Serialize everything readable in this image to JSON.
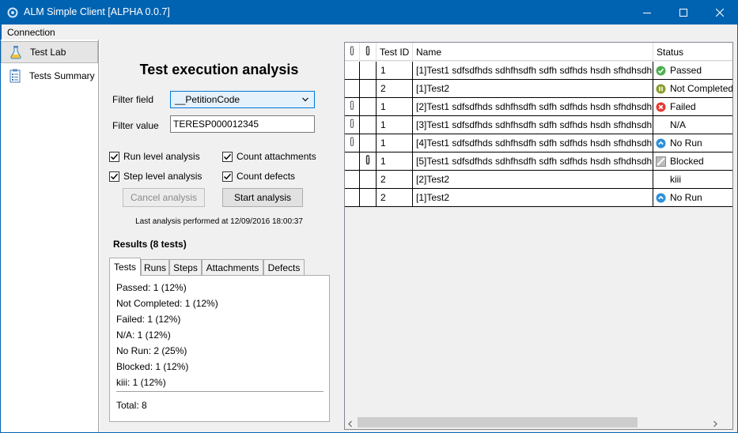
{
  "window": {
    "title": "ALM Simple Client [ALPHA 0.0.7]",
    "accent": "#0063b1"
  },
  "menu": {
    "connection": "Connection"
  },
  "nav": {
    "items": [
      {
        "label": "Test Lab",
        "icon": "flask-icon"
      },
      {
        "label": "Tests Summary",
        "icon": "clipboard-icon"
      }
    ]
  },
  "analysis": {
    "title": "Test execution analysis",
    "filter_field_label": "Filter field",
    "filter_field_value": "__PetitionCode",
    "filter_value_label": "Filter value",
    "filter_value": "TERESP000012345",
    "run_level": "Run level analysis",
    "step_level": "Step level analysis",
    "count_attachments": "Count attachments",
    "count_defects": "Count defects",
    "cancel_label": "Cancel analysis",
    "start_label": "Start analysis",
    "last_analysis": "Last analysis performed at 12/09/2016 18:00:37",
    "results_title": "Results (8 tests)"
  },
  "tabs": [
    "Tests",
    "Runs",
    "Steps",
    "Attachments",
    "Defects"
  ],
  "results": [
    "Passed: 1 (12%)",
    "Not Completed: 1 (12%)",
    "Failed: 1 (12%)",
    "N/A: 1 (12%)",
    "No Run: 2 (25%)",
    "Blocked: 1 (12%)",
    "kiii: 1 (12%)"
  ],
  "total": "Total: 8",
  "grid": {
    "headers": [
      "",
      "",
      "Test ID",
      "Name",
      "Status"
    ],
    "rows": [
      {
        "clip1": false,
        "clip2": false,
        "id": "1",
        "name": "[1]Test1 sdfsdfhds sdhfhsdfh sdfh sdfhds hsdh sfhdhsdh",
        "status": "Passed",
        "icon": "passed"
      },
      {
        "clip1": false,
        "clip2": false,
        "id": "2",
        "name": "[1]Test2",
        "status": "Not Completed",
        "icon": "notcompleted"
      },
      {
        "clip1": true,
        "clip2": false,
        "id": "1",
        "name": "[2]Test1 sdfsdfhds sdhfhsdfh sdfh sdfhds hsdh sfhdhsdh",
        "status": "Failed",
        "icon": "failed"
      },
      {
        "clip1": true,
        "clip2": false,
        "id": "1",
        "name": "[3]Test1 sdfsdfhds sdhfhsdfh sdfh sdfhds hsdh sfhdhsdh",
        "status": "N/A",
        "icon": "none"
      },
      {
        "clip1": true,
        "clip2": false,
        "id": "1",
        "name": "[4]Test1 sdfsdfhds sdhfhsdfh sdfh sdfhds hsdh sfhdhsdh",
        "status": "No Run",
        "icon": "norun"
      },
      {
        "clip1": false,
        "clip2": true,
        "id": "1",
        "name": "[5]Test1 sdfsdfhds sdhfhsdfh sdfh sdfhds hsdh sfhdhsdh",
        "status": "Blocked",
        "icon": "blocked"
      },
      {
        "clip1": false,
        "clip2": false,
        "id": "2",
        "name": "[2]Test2",
        "status": "kiii",
        "icon": "none"
      },
      {
        "clip1": false,
        "clip2": false,
        "id": "2",
        "name": "[1]Test2",
        "status": "No Run",
        "icon": "norun"
      }
    ]
  }
}
